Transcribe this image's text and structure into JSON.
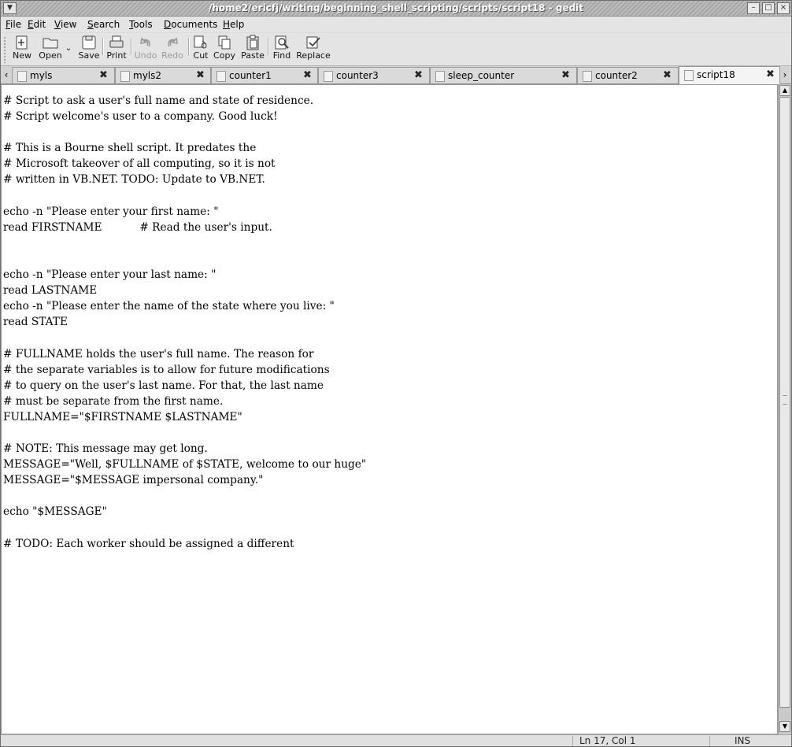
{
  "window": {
    "title": "/home2/ericfj/writing/beginning_shell_scripting/scripts/script18 - gedit"
  },
  "menubar": [
    "File",
    "Edit",
    "View",
    "Search",
    "Tools",
    "Documents",
    "Help"
  ],
  "toolbar": {
    "new": "New",
    "open": "Open",
    "save": "Save",
    "print": "Print",
    "undo": "Undo",
    "redo": "Redo",
    "cut": "Cut",
    "copy": "Copy",
    "paste": "Paste",
    "find": "Find",
    "replace": "Replace"
  },
  "tabs": [
    "myls",
    "myls2",
    "counter1",
    "counter3",
    "sleep_counter",
    "counter2",
    "script18"
  ],
  "active_tab": "script18",
  "editor": {
    "text": "# Script to ask a user's full name and state of residence.\n# Script welcome's user to a company. Good luck!\n\n# This is a Bourne shell script. It predates the\n# Microsoft takeover of all computing, so it is not\n# written in VB.NET. TODO: Update to VB.NET.\n\necho -n \"Please enter your first name: \"\nread FIRSTNAME           # Read the user's input.\n\n\necho -n \"Please enter your last name: \"\nread LASTNAME\necho -n \"Please enter the name of the state where you live: \"\nread STATE\n\n# FULLNAME holds the user's full name. The reason for\n# the separate variables is to allow for future modifications\n# to query on the user's last name. For that, the last name\n# must be separate from the first name.\nFULLNAME=\"$FIRSTNAME $LASTNAME\"\n\n# NOTE: This message may get long.\nMESSAGE=\"Well, $FULLNAME of $STATE, welcome to our huge\"\nMESSAGE=\"$MESSAGE impersonal company.\"\n\necho \"$MESSAGE\"\n\n# TODO: Each worker should be assigned a different"
  },
  "statusbar": {
    "position": "Ln 17, Col 1",
    "mode": "INS"
  }
}
